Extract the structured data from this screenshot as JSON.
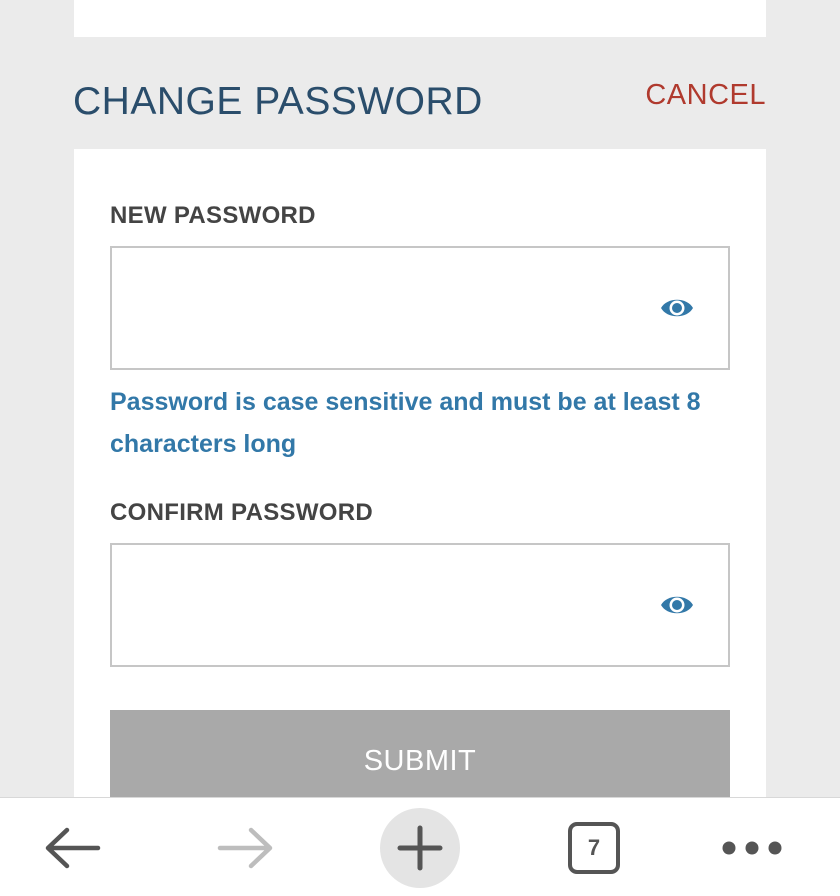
{
  "header": {
    "title": "CHANGE PASSWORD",
    "cancel_label": "CANCEL"
  },
  "form": {
    "new_password_label": "NEW PASSWORD",
    "new_password_value": "",
    "hint": "Password is case sensitive and must be at least 8 characters long",
    "confirm_password_label": "CONFIRM PASSWORD",
    "confirm_password_value": "",
    "submit_label": "SUBMIT"
  },
  "browser_bar": {
    "tab_count": "7",
    "icons": [
      "back-arrow-icon",
      "forward-arrow-icon",
      "plus-icon",
      "tabs-icon",
      "more-icon"
    ]
  },
  "colors": {
    "title": "#2a4d6b",
    "cancel": "#b03a2e",
    "hint": "#3278a8",
    "eye_icon": "#3278a8",
    "submit_bg": "#a9a9a9",
    "page_bg": "#ebebeb"
  }
}
